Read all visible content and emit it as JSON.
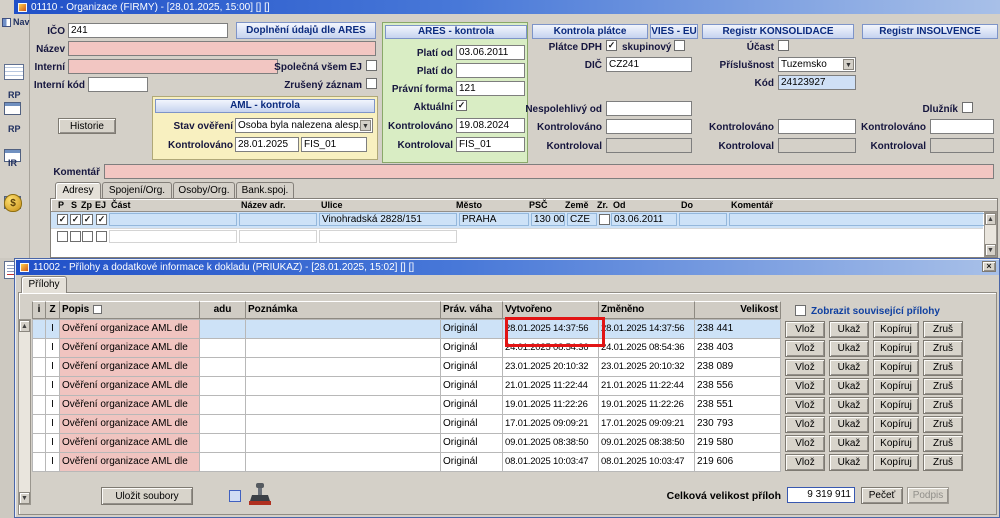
{
  "org_window": {
    "title": "01110 - Organizace (FIRMY) - [28.01.2025, 15:00] [] []",
    "sidebar": {
      "nav": "Nav",
      "groups": [
        "RP",
        "RP",
        "IR"
      ]
    },
    "form": {
      "ico_label": "IČO",
      "ico_value": "241",
      "ares_button": "Doplnění údajů dle ARES",
      "nazev_label": "Název",
      "interni_label": "Interní",
      "spolecna_label": "Společná všem EJ",
      "interni_kod_label": "Interní kód",
      "zruseny_label": "Zrušený záznam",
      "historie_button": "Historie",
      "komentar_label": "Komentář",
      "aml": {
        "header": "AML - kontrola",
        "stav_label": "Stav ověření",
        "stav_value": "Osoba byla nalezena alesp...",
        "kontrolovano_label": "Kontrolováno",
        "kontrolovano_value": "28.01.2025",
        "kontroloval_value": "FIS_01"
      },
      "ares": {
        "header": "ARES - kontrola",
        "plati_od_label": "Platí od",
        "plati_od_value": "03.06.2011",
        "plati_do_label": "Platí do",
        "pravni_forma_label": "Právní forma",
        "pravni_forma_value": "121",
        "aktualni_label": "Aktuální",
        "kontrolovano_label": "Kontrolováno",
        "kontrolovano_value": "19.08.2024",
        "kontroloval_label": "Kontroloval",
        "kontroloval_value": "FIS_01"
      },
      "platce": {
        "header": "Kontrola plátce",
        "vies_header": "VIES - EU",
        "dph_label": "Plátce DPH",
        "skupinovy_label": "skupinový",
        "dic_label": "DIČ",
        "dic_value": "CZ241",
        "nespolehlivy_label": "Nespolehlivý od",
        "kontrolovano_label": "Kontrolováno",
        "kontroloval_label": "Kontroloval"
      },
      "konsolidace": {
        "header": "Registr KONSOLIDACE",
        "ucast_label": "Účast",
        "prislusnost_label": "Příslušnost",
        "prislusnost_value": "Tuzemsko",
        "kod_label": "Kód",
        "kod_value": "24123927",
        "kontrolovano_label": "Kontrolováno",
        "kontroloval_label": "Kontroloval"
      },
      "insolvence": {
        "header": "Registr INSOLVENCE",
        "dluznik_label": "Dlužník",
        "kontrolovano_label": "Kontrolováno",
        "kontroloval_label": "Kontroloval"
      }
    },
    "tabs": [
      "Adresy",
      "Spojení/Org.",
      "Osoby/Org.",
      "Bank.spoj."
    ],
    "address_table": {
      "headers": {
        "p": "P",
        "s": "S",
        "zp": "Zp",
        "ej": "EJ",
        "cast": "Část",
        "nazev": "Název adr.",
        "ulice": "Ulice",
        "mesto": "Město",
        "psc": "PSČ",
        "zeme": "Země",
        "zr": "Zr.",
        "od": "Od",
        "do": "Do",
        "komentar": "Komentář"
      },
      "row1": {
        "ulice": "Vinohradská 2828/151",
        "mesto": "PRAHA",
        "psc": "130 00",
        "zeme": "CZE",
        "od": "03.06.2011"
      }
    }
  },
  "attach_window": {
    "title": "11002 - Přílohy a dodatkové informace k dokladu (PRIUKAZ) - [28.01.2025, 15:02] [] []",
    "tab": "Přílohy",
    "table": {
      "headers": {
        "i": "i",
        "z": "Z",
        "popis": "Popis",
        "adu": "adu",
        "poznamka": "Poznámka",
        "vaha": "Práv. váha",
        "vytvoreno": "Vytvořeno",
        "zmeneno": "Změněno",
        "velikost": "Velikost"
      },
      "show_related": "Zobrazit související přílohy",
      "buttons": [
        "Vlož",
        "Ukaž",
        "Kopíruj",
        "Zruš"
      ],
      "rows": [
        {
          "z": "I",
          "popis": "Ověření organizace AML dle",
          "vaha": "Originál",
          "vytvoreno": "28.01.2025 14:37:56",
          "zmeneno": "28.01.2025 14:37:56",
          "velikost": "238 441",
          "selected": true
        },
        {
          "z": "I",
          "popis": "Ověření organizace AML dle",
          "vaha": "Originál",
          "vytvoreno": "24.01.2025 08:54:36",
          "zmeneno": "24.01.2025 08:54:36",
          "velikost": "238 403"
        },
        {
          "z": "I",
          "popis": "Ověření organizace AML dle",
          "vaha": "Originál",
          "vytvoreno": "23.01.2025 20:10:32",
          "zmeneno": "23.01.2025 20:10:32",
          "velikost": "238 089"
        },
        {
          "z": "I",
          "popis": "Ověření organizace AML dle",
          "vaha": "Originál",
          "vytvoreno": "21.01.2025 11:22:44",
          "zmeneno": "21.01.2025 11:22:44",
          "velikost": "238 556"
        },
        {
          "z": "I",
          "popis": "Ověření organizace AML dle",
          "vaha": "Originál",
          "vytvoreno": "19.01.2025 11:22:26",
          "zmeneno": "19.01.2025 11:22:26",
          "velikost": "238 551"
        },
        {
          "z": "I",
          "popis": "Ověření organizace AML dle",
          "vaha": "Originál",
          "vytvoreno": "17.01.2025 09:09:21",
          "zmeneno": "17.01.2025 09:09:21",
          "velikost": "230 793"
        },
        {
          "z": "I",
          "popis": "Ověření organizace AML dle",
          "vaha": "Originál",
          "vytvoreno": "09.01.2025 08:38:50",
          "zmeneno": "09.01.2025 08:38:50",
          "velikost": "219 580"
        },
        {
          "z": "I",
          "popis": "Ověření organizace AML dle",
          "vaha": "Originál",
          "vytvoreno": "08.01.2025 10:03:47",
          "zmeneno": "08.01.2025 10:03:47",
          "velikost": "219 606"
        }
      ]
    },
    "footer": {
      "save_button": "Uložit soubory",
      "total_label": "Celková velikost příloh",
      "total_value": "9 319 911",
      "pecet_button": "Pečeť",
      "podpis_button": "Podpis"
    }
  }
}
